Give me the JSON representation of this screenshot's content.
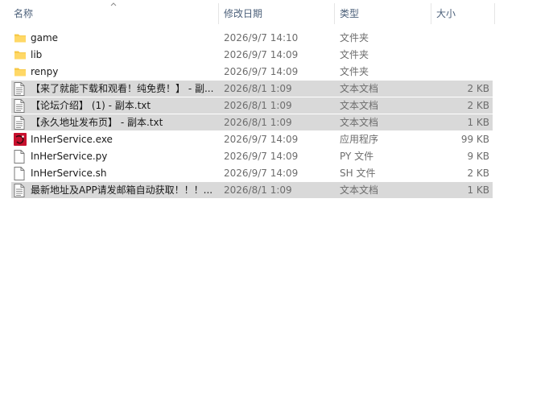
{
  "header": {
    "name": "名称",
    "date": "修改日期",
    "type": "类型",
    "size": "大小"
  },
  "colors": {
    "selected_row": "#d9d9d9",
    "folder": "#f7c948",
    "header_text": "#4c607a",
    "secondary_text": "#6d6d6d",
    "app_icon": "#c8102e"
  },
  "files": [
    {
      "name": "game",
      "date": "2026/9/7 14:10",
      "type": "文件夹",
      "size": "",
      "icon": "folder-icon",
      "selected": false
    },
    {
      "name": "lib",
      "date": "2026/9/7 14:09",
      "type": "文件夹",
      "size": "",
      "icon": "folder-icon",
      "selected": false
    },
    {
      "name": "renpy",
      "date": "2026/9/7 14:09",
      "type": "文件夹",
      "size": "",
      "icon": "folder-icon",
      "selected": false
    },
    {
      "name": "【来了就能下载和观看！纯免费！】 - 副...",
      "date": "2026/8/1 1:09",
      "type": "文本文档",
      "size": "2 KB",
      "icon": "text-file-icon",
      "selected": true
    },
    {
      "name": "【论坛介绍】 (1) - 副本.txt",
      "date": "2026/8/1 1:09",
      "type": "文本文档",
      "size": "2 KB",
      "icon": "text-file-icon",
      "selected": true
    },
    {
      "name": "【永久地址发布页】 - 副本.txt",
      "date": "2026/8/1 1:09",
      "type": "文本文档",
      "size": "1 KB",
      "icon": "text-file-icon",
      "selected": true
    },
    {
      "name": "InHerService.exe",
      "date": "2026/9/7 14:09",
      "type": "应用程序",
      "size": "99 KB",
      "icon": "app-exe-icon",
      "selected": false
    },
    {
      "name": "InHerService.py",
      "date": "2026/9/7 14:09",
      "type": "PY 文件",
      "size": "9 KB",
      "icon": "blank-file-icon",
      "selected": false
    },
    {
      "name": "InHerService.sh",
      "date": "2026/9/7 14:09",
      "type": "SH 文件",
      "size": "2 KB",
      "icon": "blank-file-icon",
      "selected": false
    },
    {
      "name": "最新地址及APP请发邮箱自动获取！！！...",
      "date": "2026/8/1 1:09",
      "type": "文本文档",
      "size": "1 KB",
      "icon": "text-file-icon",
      "selected": true
    }
  ]
}
